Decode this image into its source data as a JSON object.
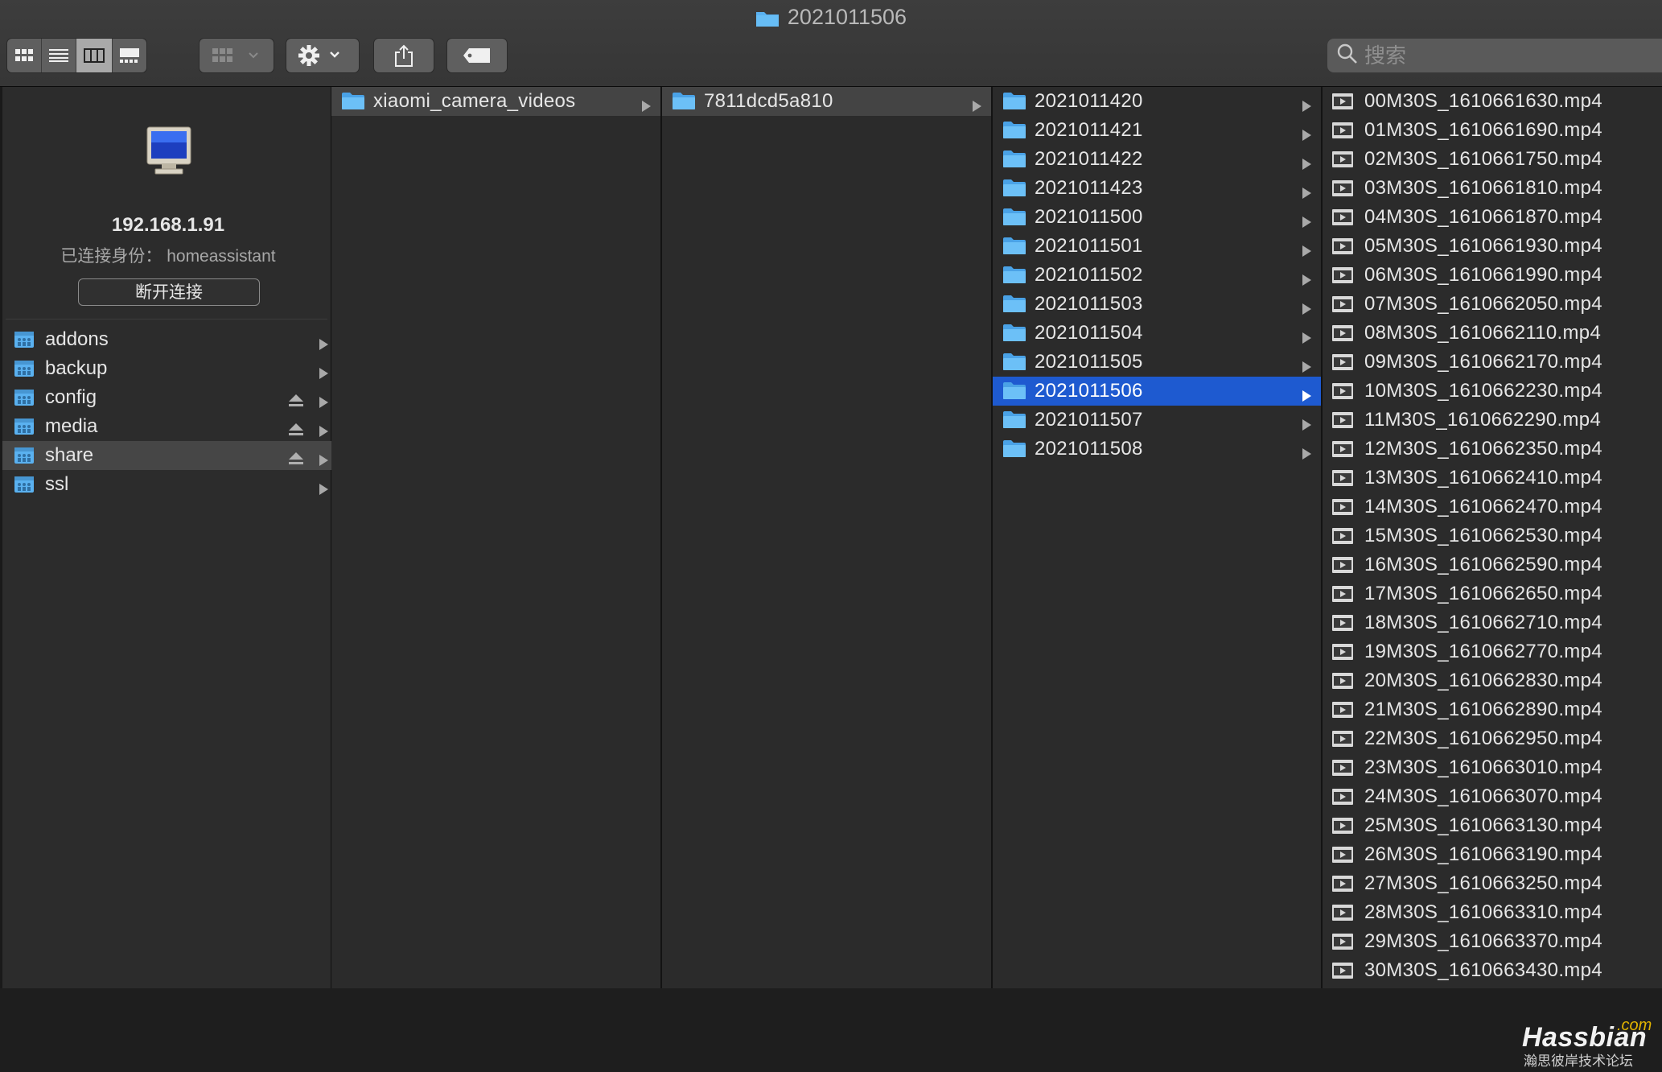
{
  "window": {
    "title": "2021011506"
  },
  "toolbar": {
    "view_buttons": [
      "icon-view",
      "list-view",
      "column-view",
      "gallery-view"
    ],
    "active_view": "column-view",
    "group_button": "group-by-icon",
    "action_button": "gear-icon",
    "share_button": "share-icon",
    "tag_button": "tag-icon",
    "search_placeholder": "搜索"
  },
  "sidebar": {
    "server_ip": "192.168.1.91",
    "connected_as": "已连接身份：  homeassistant",
    "disconnect_label": "断开连接",
    "shares": [
      {
        "name": "addons",
        "eject": false,
        "selected": false
      },
      {
        "name": "backup",
        "eject": false,
        "selected": false
      },
      {
        "name": "config",
        "eject": true,
        "selected": false
      },
      {
        "name": "media",
        "eject": true,
        "selected": false
      },
      {
        "name": "share",
        "eject": true,
        "selected": true
      },
      {
        "name": "ssl",
        "eject": false,
        "selected": false
      }
    ]
  },
  "columns": {
    "col1": [
      {
        "name": "xiaomi_camera_videos",
        "selected": "parent"
      }
    ],
    "col2": [
      {
        "name": "7811dcd5a810",
        "selected": "parent"
      }
    ],
    "col3": [
      {
        "name": "2021011420"
      },
      {
        "name": "2021011421"
      },
      {
        "name": "2021011422"
      },
      {
        "name": "2021011423"
      },
      {
        "name": "2021011500"
      },
      {
        "name": "2021011501"
      },
      {
        "name": "2021011502"
      },
      {
        "name": "2021011503"
      },
      {
        "name": "2021011504"
      },
      {
        "name": "2021011505"
      },
      {
        "name": "2021011506",
        "selected": "active"
      },
      {
        "name": "2021011507"
      },
      {
        "name": "2021011508"
      }
    ],
    "col4": [
      "00M30S_1610661630.mp4",
      "01M30S_1610661690.mp4",
      "02M30S_1610661750.mp4",
      "03M30S_1610661810.mp4",
      "04M30S_1610661870.mp4",
      "05M30S_1610661930.mp4",
      "06M30S_1610661990.mp4",
      "07M30S_1610662050.mp4",
      "08M30S_1610662110.mp4",
      "09M30S_1610662170.mp4",
      "10M30S_1610662230.mp4",
      "11M30S_1610662290.mp4",
      "12M30S_1610662350.mp4",
      "13M30S_1610662410.mp4",
      "14M30S_1610662470.mp4",
      "15M30S_1610662530.mp4",
      "16M30S_1610662590.mp4",
      "17M30S_1610662650.mp4",
      "18M30S_1610662710.mp4",
      "19M30S_1610662770.mp4",
      "20M30S_1610662830.mp4",
      "21M30S_1610662890.mp4",
      "22M30S_1610662950.mp4",
      "23M30S_1610663010.mp4",
      "24M30S_1610663070.mp4",
      "25M30S_1610663130.mp4",
      "26M30S_1610663190.mp4",
      "27M30S_1610663250.mp4",
      "28M30S_1610663310.mp4",
      "29M30S_1610663370.mp4",
      "30M30S_1610663430.mp4"
    ]
  },
  "watermark": {
    "brand": "Hassbian",
    "suffix": "com",
    "tagline": "瀚思彼岸技术论坛"
  },
  "colors": {
    "selection": "#1e5ad0",
    "folder": "#5ab1f0",
    "background": "#2b2b2b"
  }
}
